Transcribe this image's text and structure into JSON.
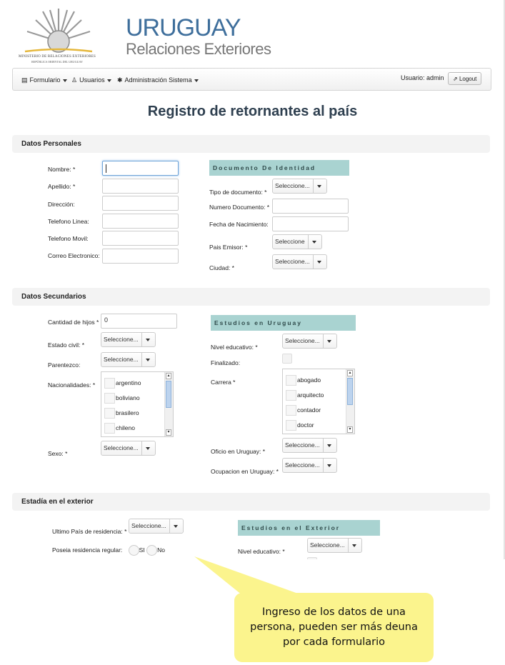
{
  "brand": {
    "title": "URUGUAY",
    "subtitle": "Relaciones Exteriores",
    "ministry_line1": "MINISTERIO DE RELACIONES EXTERIORES",
    "ministry_line2": "REPÚBLICA ORIENTAL DEL URUGUAY"
  },
  "nav": {
    "formulario": "Formulario",
    "usuarios": "Usuarios",
    "admin": "Administración Sistema",
    "user_label": "Usuario: admin",
    "logout": "Logout"
  },
  "page_title": "Registro de retornantes al país",
  "datos_personales": {
    "header": "Datos Personales",
    "nombre": "Nombre: *",
    "apellido": "Apellido: *",
    "direccion": "Dirección:",
    "tel_linea": "Telefono Linea:",
    "tel_movil": "Telefono Movil:",
    "correo": "Correo Electronico:",
    "doc_header": "Documento De Identidad",
    "tipo_doc": "Tipo de documento: *",
    "tipo_doc_value": "Seleccione...",
    "numero_doc": "Numero Documento: *",
    "fecha_nac": "Fecha de Nacimiento:",
    "pais_emisor": "Pais Emisor: *",
    "pais_emisor_value": "Seleccione",
    "ciudad": "Ciudad: *",
    "ciudad_value": "Seleccione..."
  },
  "datos_secundarios": {
    "header": "Datos Secundarios",
    "cantidad_hijos": "Cantidad de hijos *",
    "cantidad_hijos_value": "0",
    "estado_civil": "Estado civil: *",
    "estado_civil_value": "Seleccione...",
    "parentezco": "Parentezco:",
    "parentezco_value": "Seleccione...",
    "nacionalidades": "Nacionalidades: *",
    "nacionalidades_options": [
      "argentino",
      "boliviano",
      "brasilero",
      "chileno"
    ],
    "sexo": "Sexo: *",
    "sexo_value": "Seleccione...",
    "estudios_header": "Estudios en Uruguay",
    "nivel_educativo": "Nivel educativo: *",
    "nivel_educativo_value": "Seleccione...",
    "finalizado": "Finalizado:",
    "carrera": "Carrera *",
    "carrera_options": [
      "abogado",
      "arquitecto",
      "contador",
      "doctor"
    ],
    "oficio": "Oficio en Uruguay: *",
    "oficio_value": "Seleccione...",
    "ocupacion": "Ocupacion en Uruguay: *",
    "ocupacion_value": "Seleccione..."
  },
  "estadia": {
    "header": "Estadía en el exterior",
    "ultimo_pais": "Ultimo País de residencia: *",
    "ultimo_pais_value": "Seleccione...",
    "poseia": "Poseia residencia regular:",
    "si": "SI",
    "no": "No",
    "estudios_ext_header": "Estudios en el Exterior",
    "nivel_educativo": "Nivel educativo: *",
    "nivel_educativo_value": "Seleccione..."
  },
  "callout": {
    "text": "Ingreso de los datos de una persona, pueden ser más deuna por cada formulario"
  },
  "colors": {
    "brand_blue": "#3f6f9c",
    "subheader_teal": "#a9d3d1",
    "callout_yellow": "#fbf48d"
  }
}
